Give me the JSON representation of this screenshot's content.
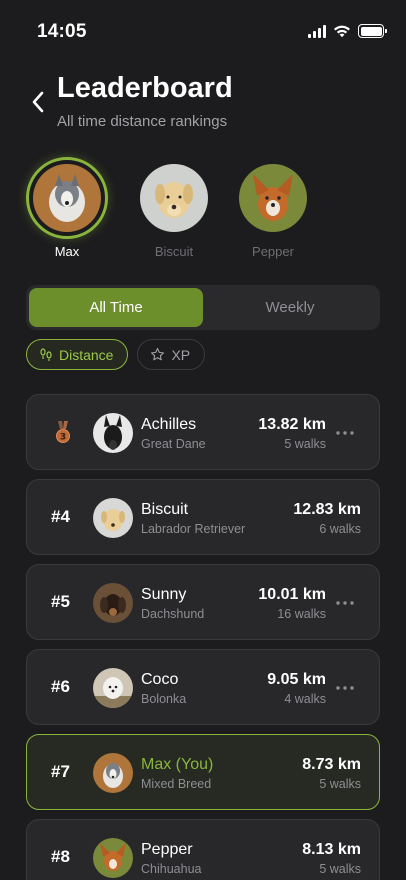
{
  "status_bar": {
    "time": "14:05"
  },
  "header": {
    "title": "Leaderboard",
    "subtitle": "All time distance rankings"
  },
  "dogs": [
    {
      "name": "Max",
      "active": true
    },
    {
      "name": "Biscuit",
      "active": false
    },
    {
      "name": "Pepper",
      "active": false
    }
  ],
  "range_tabs": [
    {
      "label": "All Time",
      "active": true
    },
    {
      "label": "Weekly",
      "active": false
    }
  ],
  "metric_chips": [
    {
      "label": "Distance",
      "icon": "footprints-icon",
      "active": true
    },
    {
      "label": "XP",
      "icon": "star-icon",
      "active": false
    }
  ],
  "rankings": [
    {
      "rank": "3",
      "name": "Achilles",
      "breed": "Great Dane",
      "distance": "13.82 km",
      "walks": "5 walks"
    },
    {
      "rank": "#4",
      "name": "Biscuit",
      "breed": "Labrador Retriever",
      "distance": "12.83 km",
      "walks": "6 walks"
    },
    {
      "rank": "#5",
      "name": "Sunny",
      "breed": "Dachshund",
      "distance": "10.01 km",
      "walks": "16 walks"
    },
    {
      "rank": "#6",
      "name": "Coco",
      "breed": "Bolonka",
      "distance": "9.05 km",
      "walks": "4 walks"
    },
    {
      "rank": "#7",
      "name": "Max (You)",
      "breed": "Mixed Breed",
      "distance": "8.73 km",
      "walks": "5 walks"
    },
    {
      "rank": "#8",
      "name": "Pepper",
      "breed": "Chihuahua",
      "distance": "8.13 km",
      "walks": "5 walks"
    }
  ],
  "colors": {
    "accent": "#8ab53c",
    "tab_active": "#6c8f2c",
    "bronze": "#c06a3a"
  }
}
